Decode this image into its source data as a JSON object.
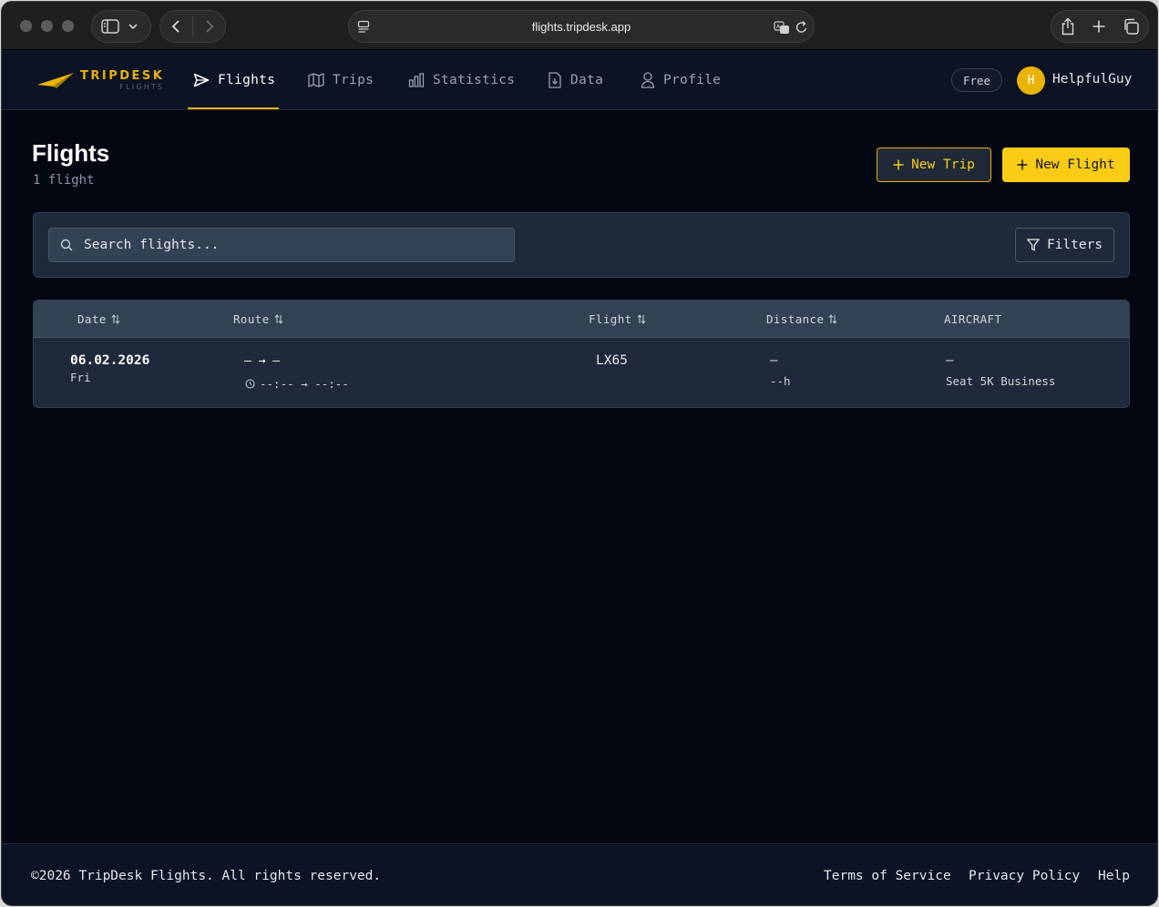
{
  "browser": {
    "url": "flights.tripdesk.app"
  },
  "brand": {
    "name": "TRIPDESK",
    "sub": "FLIGHTS",
    "accent": "#eab308"
  },
  "nav": {
    "items": [
      {
        "label": "Flights",
        "icon": "send-icon",
        "active": true
      },
      {
        "label": "Trips",
        "icon": "map-icon"
      },
      {
        "label": "Statistics",
        "icon": "bar-chart-icon"
      },
      {
        "label": "Data",
        "icon": "file-download-icon"
      },
      {
        "label": "Profile",
        "icon": "user-icon"
      }
    ],
    "plan_badge": "Free",
    "avatar_initial": "H",
    "username": "HelpfulGuy"
  },
  "page": {
    "title": "Flights",
    "count": "1 flight",
    "new_trip_label": "New Trip",
    "new_flight_label": "New Flight"
  },
  "search": {
    "placeholder": "Search flights...",
    "filters_label": "Filters"
  },
  "table": {
    "headers": {
      "date": "Date",
      "route": "Route",
      "flight": "Flight",
      "distance": "Distance",
      "aircraft": "AIRCRAFT"
    },
    "rows": [
      {
        "date": "06.02.2026",
        "weekday": "Fri",
        "route": "— → —",
        "times": "--:-- → --:--",
        "flight": "LX65",
        "distance": "—",
        "duration": "--h",
        "aircraft": "—",
        "seat": "Seat 5K Business"
      }
    ]
  },
  "footer": {
    "copyright": "©2026 TripDesk Flights. All rights reserved.",
    "links": [
      "Terms of Service",
      "Privacy Policy",
      "Help"
    ]
  }
}
